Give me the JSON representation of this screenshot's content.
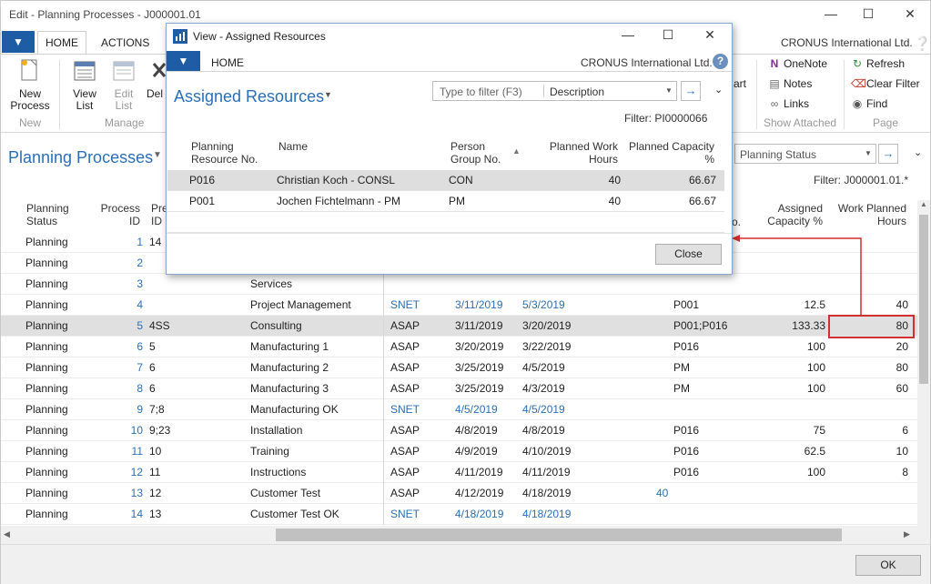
{
  "window": {
    "title": "Edit - Planning Processes - J000001.01",
    "company": "CRONUS International Ltd."
  },
  "ribbon": {
    "tabs": [
      "HOME",
      "ACTIONS"
    ],
    "new_process": "New\nProcess",
    "new_group": "New",
    "view_list": "View\nList",
    "edit_list": "Edit\nList",
    "delete_partial": "Del",
    "manage_group": "Manage",
    "chart_partial": "art",
    "onenote": "OneNote",
    "notes": "Notes",
    "links": "Links",
    "show_attached_group": "Show Attached",
    "refresh": "Refresh",
    "clear_filter": "Clear Filter",
    "find": "Find",
    "page_group": "Page"
  },
  "page": {
    "title": "Planning Processes",
    "filter_field": "Planning Status",
    "filter_text": "Filter: J000001.01.*"
  },
  "grid": {
    "headers": {
      "status": "Planning\nStatus",
      "process_id": "Process\nID",
      "pre_id_partial": "Pre\nID",
      "res_partial": "o.",
      "assigned_capacity": "Assigned\nCapacity %",
      "work_planned": "Work Planned\nHours"
    },
    "rows": [
      {
        "status": "Planning",
        "id": "1",
        "pre": "14",
        "desc": "",
        "calc": "",
        "start": "",
        "end": "",
        "res": "",
        "cap": "",
        "hours": ""
      },
      {
        "status": "Planning",
        "id": "2",
        "pre": "",
        "desc": "",
        "calc": "",
        "start": "",
        "end": "",
        "res": "",
        "cap": "",
        "hours": ""
      },
      {
        "status": "Planning",
        "id": "3",
        "pre": "",
        "desc": "Services",
        "calc": "",
        "start": "",
        "end": "",
        "res": "",
        "cap": "",
        "hours": ""
      },
      {
        "status": "Planning",
        "id": "4",
        "pre": "",
        "desc": "Project Management",
        "calc": "SNET",
        "start": "3/11/2019",
        "end": "5/3/2019",
        "res": "P001",
        "cap": "12.5",
        "hours": "40"
      },
      {
        "status": "Planning",
        "id": "5",
        "pre": "4SS",
        "desc": "Consulting",
        "calc": "ASAP",
        "start": "3/11/2019",
        "end": "3/20/2019",
        "res": "P001;P016",
        "cap": "133.33",
        "hours": "80"
      },
      {
        "status": "Planning",
        "id": "6",
        "pre": "5",
        "desc": "Manufacturing 1",
        "calc": "ASAP",
        "start": "3/20/2019",
        "end": "3/22/2019",
        "res": "P016",
        "cap": "100",
        "hours": "20"
      },
      {
        "status": "Planning",
        "id": "7",
        "pre": "6",
        "desc": "Manufacturing 2",
        "calc": "ASAP",
        "start": "3/25/2019",
        "end": "4/5/2019",
        "res": "PM",
        "cap": "100",
        "hours": "80"
      },
      {
        "status": "Planning",
        "id": "8",
        "pre": "6",
        "desc": "Manufacturing 3",
        "calc": "ASAP",
        "start": "3/25/2019",
        "end": "4/3/2019",
        "res": "PM",
        "cap": "100",
        "hours": "60"
      },
      {
        "status": "Planning",
        "id": "9",
        "pre": "7;8",
        "desc": "Manufacturing OK",
        "calc": "SNET",
        "start": "4/5/2019",
        "end": "4/5/2019",
        "res": "",
        "cap": "",
        "hours": ""
      },
      {
        "status": "Planning",
        "id": "10",
        "pre": "9;23",
        "desc": "Installation",
        "calc": "ASAP",
        "start": "4/8/2019",
        "end": "4/8/2019",
        "res": "P016",
        "cap": "75",
        "hours": "6"
      },
      {
        "status": "Planning",
        "id": "11",
        "pre": "10",
        "desc": "Training",
        "calc": "ASAP",
        "start": "4/9/2019",
        "end": "4/10/2019",
        "res": "P016",
        "cap": "62.5",
        "hours": "10"
      },
      {
        "status": "Planning",
        "id": "12",
        "pre": "11",
        "desc": "Instructions",
        "calc": "ASAP",
        "start": "4/11/2019",
        "end": "4/11/2019",
        "res": "P016",
        "cap": "100",
        "hours": "8"
      },
      {
        "status": "Planning",
        "id": "13",
        "pre": "12",
        "desc": "Customer Test",
        "calc": "ASAP",
        "start": "4/12/2019",
        "end": "4/18/2019",
        "res": "40",
        "cap": "",
        "hours": ""
      },
      {
        "status": "Planning",
        "id": "14",
        "pre": "13",
        "desc": "Customer Test OK",
        "calc": "SNET",
        "start": "4/18/2019",
        "end": "4/18/2019",
        "res": "",
        "cap": "",
        "hours": ""
      }
    ]
  },
  "footer": {
    "ok": "OK"
  },
  "dialog": {
    "title": "View - Assigned Resources",
    "tab": "HOME",
    "company": "CRONUS International Ltd.",
    "page_title": "Assigned Resources",
    "filter_placeholder": "Type to filter (F3)",
    "filter_field": "Description",
    "filter_text": "Filter: PI0000066",
    "headers": {
      "res_no": "Planning\nResource No.",
      "name": "Name",
      "group": "Person\nGroup No.",
      "work_hours": "Planned Work\nHours",
      "capacity": "Planned Capacity\n%"
    },
    "rows": [
      {
        "no": "P016",
        "name": "Christian Koch - CONSL",
        "group": "CON",
        "hours": "40",
        "cap": "66.67"
      },
      {
        "no": "P001",
        "name": "Jochen Fichtelmann - PM",
        "group": "PM",
        "hours": "40",
        "cap": "66.67"
      }
    ],
    "close": "Close"
  },
  "colors": {
    "accent": "#1f5ca6",
    "link": "#2a6fb7",
    "annotation": "#d32f2f"
  }
}
